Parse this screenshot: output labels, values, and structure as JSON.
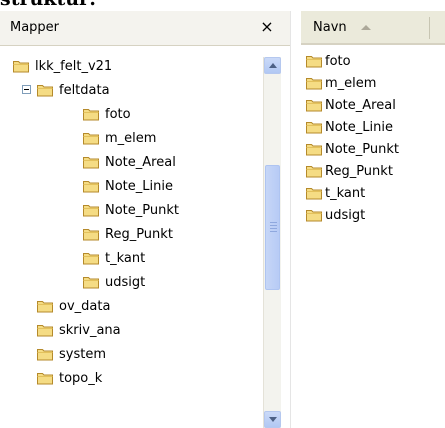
{
  "caption": "struktur:",
  "left_pane": {
    "title": "Mapper",
    "close_glyph": "×",
    "tree": [
      {
        "label": "lkk_felt_v21",
        "level": 0
      },
      {
        "label": "feltdata",
        "level": 1,
        "expanded": true
      },
      {
        "label": "foto",
        "level": 2
      },
      {
        "label": "m_elem",
        "level": 2
      },
      {
        "label": "Note_Areal",
        "level": 2
      },
      {
        "label": "Note_Linie",
        "level": 2
      },
      {
        "label": "Note_Punkt",
        "level": 2
      },
      {
        "label": "Reg_Punkt",
        "level": 2
      },
      {
        "label": "t_kant",
        "level": 2
      },
      {
        "label": "udsigt",
        "level": 2
      },
      {
        "label": "ov_data",
        "level": 1
      },
      {
        "label": "skriv_ana",
        "level": 1
      },
      {
        "label": "system",
        "level": 1
      },
      {
        "label": "topo_k",
        "level": 1
      }
    ]
  },
  "right_pane": {
    "column_header": "Navn",
    "sort_icon": "sort-ascending-icon",
    "files": [
      "foto",
      "m_elem",
      "Note_Areal",
      "Note_Linie",
      "Note_Punkt",
      "Reg_Punkt",
      "t_kant",
      "udsigt"
    ]
  },
  "colors": {
    "folder_fill": "#f5dc84",
    "folder_stroke": "#b58a2b",
    "header_bg": "#ebeadb",
    "scroll_blue": "#b7cbf5"
  }
}
